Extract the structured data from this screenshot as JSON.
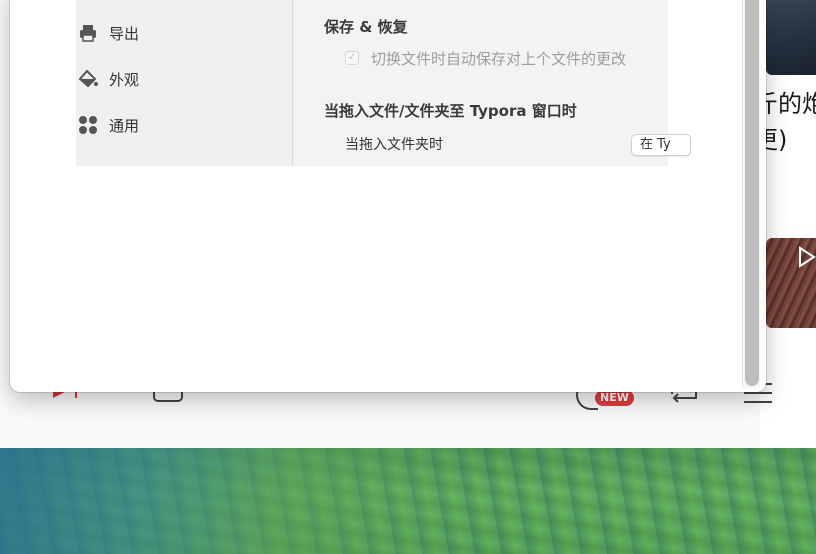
{
  "background_app": {
    "partial_text_lines": [
      "斤的炮",
      "更)"
    ],
    "new_badge": "NEW",
    "icons": [
      "next-track-icon",
      "square-icon",
      "new-feature-icon",
      "repeat-icon",
      "menu-icon",
      "play-icon"
    ]
  },
  "preferences": {
    "sidebar": {
      "items": [
        {
          "label": "导出",
          "icon": "printer-icon"
        },
        {
          "label": "外观",
          "icon": "paint-bucket-icon"
        },
        {
          "label": "通用",
          "icon": "grid-dots-icon"
        }
      ]
    },
    "save_restore": {
      "title": "保存 & 恢复",
      "autosave_checkbox_label": "切换文件时自动保存对上个文件的更改",
      "autosave_checked": true
    },
    "drag_drop": {
      "title": "当拖入文件/文件夹至 Typora 窗口时",
      "folder_label": "当拖入文件夹时",
      "folder_select_value": "在 Ty"
    }
  },
  "colors": {
    "window_bg": "#ffffff",
    "sidebar_bg": "#f0f0ee",
    "badge_red": "#e03c3c",
    "scrollbar": "#bdbdbd"
  }
}
